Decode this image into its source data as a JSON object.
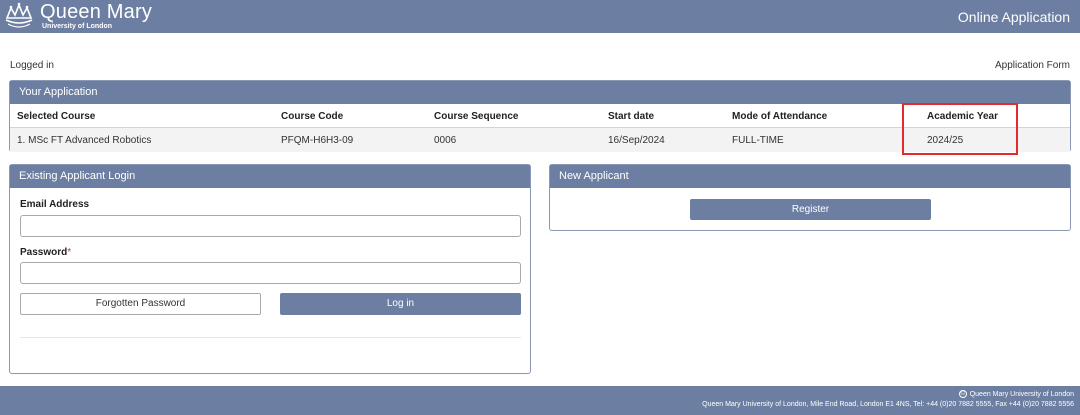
{
  "header": {
    "logo_name": "Queen Mary",
    "logo_subtitle": "University of London",
    "app_title": "Online Application"
  },
  "status": {
    "logged_in": "Logged in",
    "form_name": "Application Form"
  },
  "your_application": {
    "title": "Your Application",
    "columns": [
      "Selected Course",
      "Course Code",
      "Course Sequence",
      "Start date",
      "Mode of Attendance",
      "Academic Year"
    ],
    "row": [
      "1. MSc FT Advanced Robotics",
      "PFQM-H6H3-09",
      "0006",
      "16/Sep/2024",
      "FULL-TIME",
      "2024/25"
    ]
  },
  "login": {
    "title": "Existing Applicant Login",
    "email_label": "Email Address",
    "email_value": "",
    "password_label": "Password",
    "password_required_mark": "*",
    "password_value": "",
    "forgot_label": "Forgotten Password",
    "login_label": "Log in"
  },
  "new_applicant": {
    "title": "New Applicant",
    "register_label": "Register"
  },
  "footer": {
    "copyright": "Queen Mary University of London",
    "address": "Queen Mary University of London, Mile End Road, London E1 4NS, Tel: +44 (0)20 7882 5555, Fax +44 (0)20 7882 5556"
  },
  "colors": {
    "brand": "#6c7fa2",
    "highlight": "#e22b2b"
  }
}
